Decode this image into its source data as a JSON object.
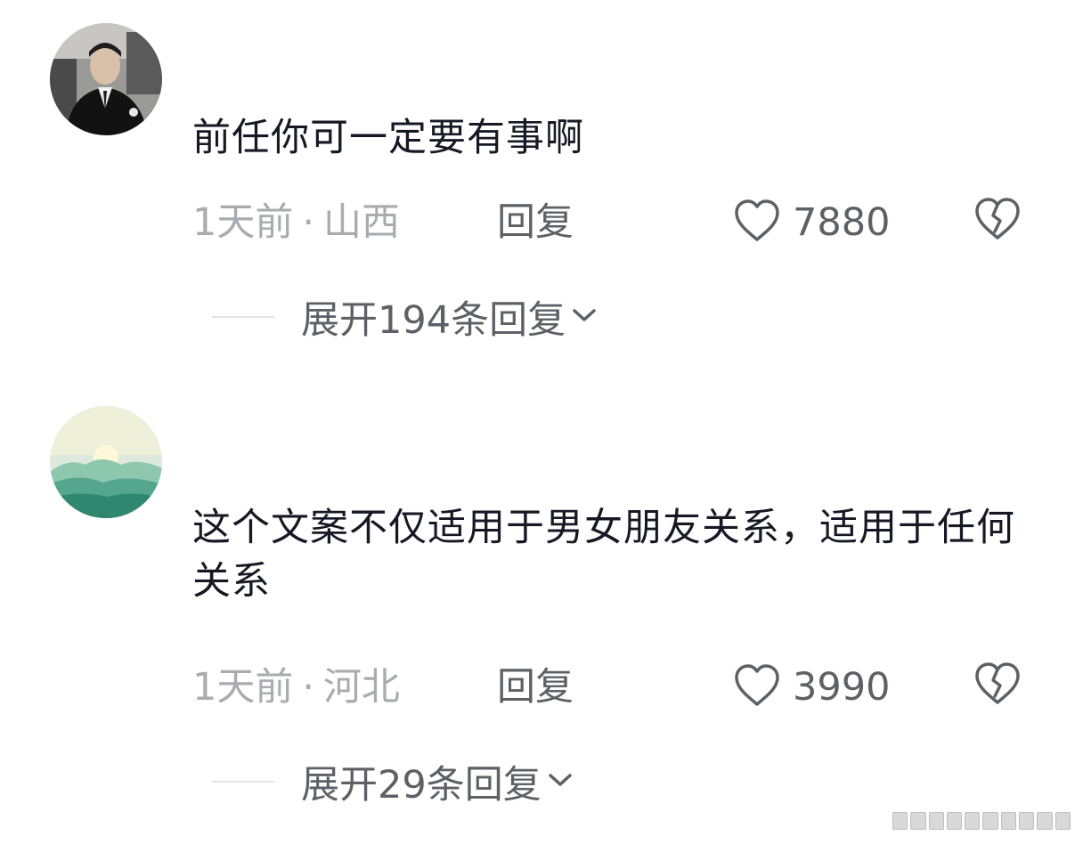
{
  "comments": [
    {
      "text": "前任你可一定要有事啊",
      "time": "1天前",
      "separator": "·",
      "location": "山西",
      "reply_label": "回复",
      "like_count": "7880",
      "expand_label": "展开194条回复"
    },
    {
      "text": "这个文案不仅适用于男女朋友关系，适用于任何关系",
      "time": "1天前",
      "separator": "·",
      "location": "河北",
      "reply_label": "回复",
      "like_count": "3990",
      "expand_label": "展开29条回复"
    }
  ],
  "icons": {
    "like": "heart-outline-icon",
    "dislike": "broken-heart-icon",
    "expand": "chevron-down-icon"
  },
  "colors": {
    "text_primary": "#161823",
    "text_secondary": "#a9abb0",
    "action": "#5e6066"
  }
}
